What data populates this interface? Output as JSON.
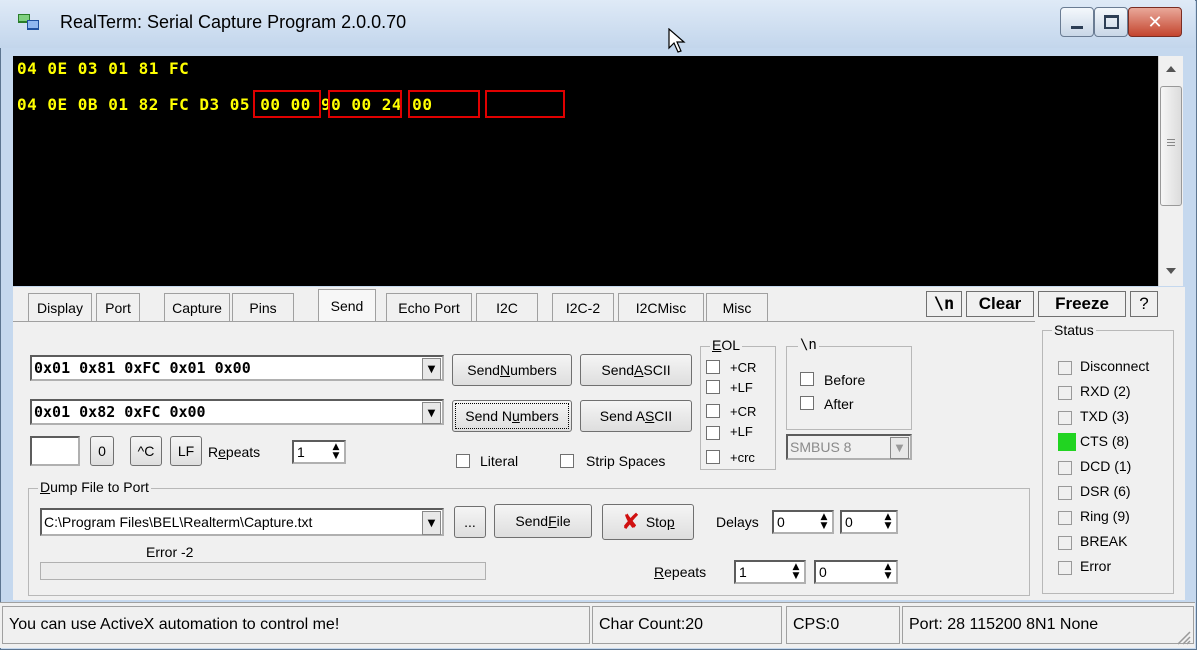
{
  "window": {
    "title": "RealTerm: Serial Capture Program 2.0.0.70"
  },
  "terminal": {
    "lines": [
      "04 0E 03 01 81 FC",
      "04 0E 0B 01 82 FC D3 05 00 00 90 00 24 00"
    ],
    "text_color": "#ffff00",
    "background": "#000000",
    "highlight_color": "#e00000",
    "highlighted_bytes": [
      "D3 05",
      "00 00",
      "90 00",
      "24 00"
    ]
  },
  "tabs": [
    {
      "label": "Display",
      "active": false
    },
    {
      "label": "Port",
      "active": false
    },
    {
      "label": "Capture",
      "active": false
    },
    {
      "label": "Pins",
      "active": false
    },
    {
      "label": "Send",
      "active": true
    },
    {
      "label": "Echo Port",
      "active": false
    },
    {
      "label": "I2C",
      "active": false
    },
    {
      "label": "I2C-2",
      "active": false
    },
    {
      "label": "I2CMisc",
      "active": false
    },
    {
      "label": "Misc",
      "active": false
    }
  ],
  "toolbar": {
    "newline_label": "\\n",
    "clear_label": "Clear",
    "freeze_label": "Freeze",
    "help_label": "?"
  },
  "send": {
    "input1": "0x01 0x81 0xFC 0x01 0x00",
    "input2": "0x01 0x82 0xFC 0x00",
    "send_numbers_pre": "Send ",
    "send_numbers_key": "N",
    "send_numbers_post": "umbers",
    "send_numbers2_pre": "Send N",
    "send_numbers2_key": "u",
    "send_numbers2_post": "mbers",
    "send_ascii_pre": "Send ",
    "send_ascii_key": "A",
    "send_ascii_post": "SCII",
    "send_ascii2_pre": "Send A",
    "send_ascii2_key": "S",
    "send_ascii2_post": "CII",
    "btn_zero": "0",
    "btn_ctrl_c": "^C",
    "btn_lf": "LF",
    "repeats_pre": "R",
    "repeats_key": "e",
    "repeats_post": "peats",
    "repeats_value": "1",
    "literal_label": "Literal",
    "strip_spaces_label": "Strip Spaces"
  },
  "eol": {
    "title_pre": "",
    "title_key": "E",
    "title_post": "OL",
    "opt1": "+CR",
    "opt2": "+LF",
    "opt3": "+CR",
    "opt4": "+LF",
    "opt5": "+crc"
  },
  "newline_group": {
    "title": "\\n",
    "before": "Before",
    "after": "After",
    "smbus": "SMBUS 8"
  },
  "dump": {
    "title_pre": "",
    "title_key": "D",
    "title_post": "ump File to Port",
    "file_path": "C:\\Program Files\\BEL\\Realterm\\Capture.txt",
    "browse_label": "...",
    "send_file_pre": "Send ",
    "send_file_key": "F",
    "send_file_post": "ile",
    "stop_pre": "Sto",
    "stop_key": "p",
    "stop_post": "",
    "delays_label": "Delays",
    "delay1": "0",
    "delay2": "0",
    "error_text": "Error -2",
    "repeats_pre": "",
    "repeats_key": "R",
    "repeats_post": "epeats",
    "repeats1": "1",
    "repeats2": "0"
  },
  "status": {
    "title": "Status",
    "items": [
      {
        "label": "Disconnect",
        "on": false
      },
      {
        "label": "RXD (2)",
        "on": false
      },
      {
        "label": "TXD (3)",
        "on": false
      },
      {
        "label": "CTS (8)",
        "on": true
      },
      {
        "label": "DCD (1)",
        "on": false
      },
      {
        "label": "DSR (6)",
        "on": false
      },
      {
        "label": "Ring (9)",
        "on": false
      },
      {
        "label": "BREAK",
        "on": false
      },
      {
        "label": "Error",
        "on": false
      }
    ],
    "led_on_color": "#21d421"
  },
  "statusbar": {
    "message": "You can use ActiveX automation to control me!",
    "char_count": "Char Count:20",
    "cps": "CPS:0",
    "port": "Port: 28 115200 8N1 None"
  }
}
